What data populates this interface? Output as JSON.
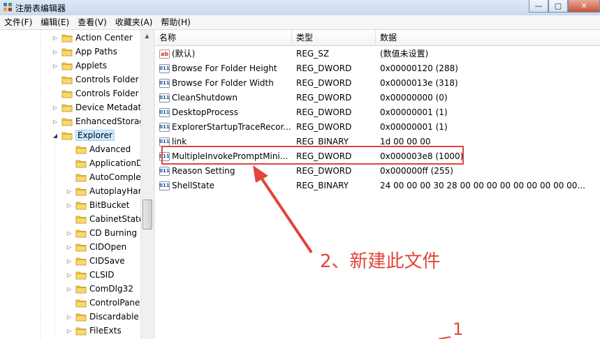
{
  "window": {
    "title": "注册表编辑器",
    "controls": [
      "—",
      "▢",
      "✕"
    ]
  },
  "menu": [
    "文件(F)",
    "编辑(E)",
    "查看(V)",
    "收藏夹(A)",
    "帮助(H)"
  ],
  "tree": {
    "items": [
      {
        "label": "Action Center",
        "arrow": "▷"
      },
      {
        "label": "App Paths",
        "arrow": "▷"
      },
      {
        "label": "Applets",
        "arrow": "▷"
      },
      {
        "label": "Controls Folder",
        "arrow": ""
      },
      {
        "label": "Controls Folder",
        "arrow": ""
      },
      {
        "label": "Device Metadat",
        "arrow": "▷"
      },
      {
        "label": "EnhancedStorag",
        "arrow": "▷"
      },
      {
        "label": "Explorer",
        "arrow": "◢"
      },
      {
        "label": "Advanced",
        "arrow": ""
      },
      {
        "label": "ApplicationD",
        "arrow": ""
      },
      {
        "label": "AutoComple",
        "arrow": ""
      },
      {
        "label": "AutoplayHar",
        "arrow": "▷"
      },
      {
        "label": "BitBucket",
        "arrow": "▷"
      },
      {
        "label": "CabinetState",
        "arrow": ""
      },
      {
        "label": "CD Burning",
        "arrow": "▷"
      },
      {
        "label": "CIDOpen",
        "arrow": "▷"
      },
      {
        "label": "CIDSave",
        "arrow": "▷"
      },
      {
        "label": "CLSID",
        "arrow": "▷"
      },
      {
        "label": "ComDlg32",
        "arrow": "▷"
      },
      {
        "label": "ControlPane",
        "arrow": ""
      },
      {
        "label": "Discardable",
        "arrow": "▷"
      },
      {
        "label": "FileExts",
        "arrow": "▷"
      }
    ]
  },
  "list": {
    "columns": [
      "名称",
      "类型",
      "数据"
    ],
    "rows": [
      {
        "icon": "ab",
        "name": "(默认)",
        "type": "REG_SZ",
        "data": "(数值未设置)"
      },
      {
        "icon": "011",
        "name": "Browse For Folder Height",
        "type": "REG_DWORD",
        "data": "0x00000120 (288)"
      },
      {
        "icon": "011",
        "name": "Browse For Folder Width",
        "type": "REG_DWORD",
        "data": "0x0000013e (318)"
      },
      {
        "icon": "011",
        "name": "CleanShutdown",
        "type": "REG_DWORD",
        "data": "0x00000000 (0)"
      },
      {
        "icon": "011",
        "name": "DesktopProcess",
        "type": "REG_DWORD",
        "data": "0x00000001 (1)"
      },
      {
        "icon": "011",
        "name": "ExplorerStartupTraceRecor...",
        "type": "REG_DWORD",
        "data": "0x00000001 (1)"
      },
      {
        "icon": "011",
        "name": "link",
        "type": "REG_BINARY",
        "data": "1d 00 00 00"
      },
      {
        "icon": "011",
        "name": "MultipleInvokePromptMini...",
        "type": "REG_DWORD",
        "data": "0x000003e8 (1000)"
      },
      {
        "icon": "011",
        "name": "Reason Setting",
        "type": "REG_DWORD",
        "data": "0x000000ff (255)"
      },
      {
        "icon": "011",
        "name": "ShellState",
        "type": "REG_BINARY",
        "data": "24 00 00 00 30 28 00 00 00 00 00 00 00 00 00..."
      }
    ]
  },
  "annotation": {
    "step2": "2、新建此文件",
    "step1": "1",
    "color": "#e0453b"
  }
}
